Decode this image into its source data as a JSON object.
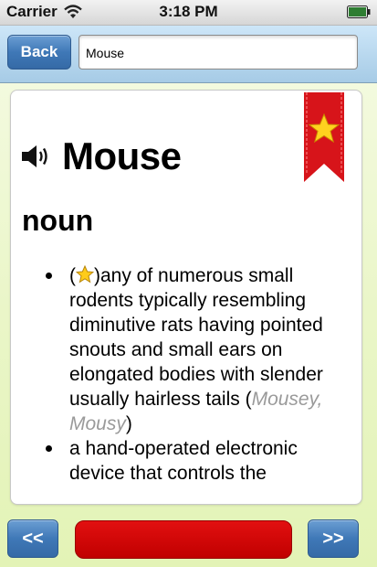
{
  "status_bar": {
    "carrier": "Carrier",
    "time": "3:18 PM"
  },
  "toolbar": {
    "back_label": "Back",
    "search_value": "Mouse"
  },
  "entry": {
    "word": "Mouse",
    "part_of_speech": "noun",
    "definitions": [
      {
        "favorite": true,
        "prefix": "(",
        "after_star": ")any of numerous small rodents typically resembling diminutive rats having pointed snouts and small ears on elongated bodies with slender usually hairless tails (",
        "synonyms": "Mousey, Mousy",
        "suffix": ")"
      },
      {
        "favorite": false,
        "text": "a hand-operated electronic device that controls the"
      }
    ]
  },
  "bottom_bar": {
    "prev_label": "<<",
    "next_label": ">>"
  },
  "colors": {
    "accent_blue": "#3f78b7",
    "red_button": "#d00808",
    "background": "#eaf6c8"
  }
}
